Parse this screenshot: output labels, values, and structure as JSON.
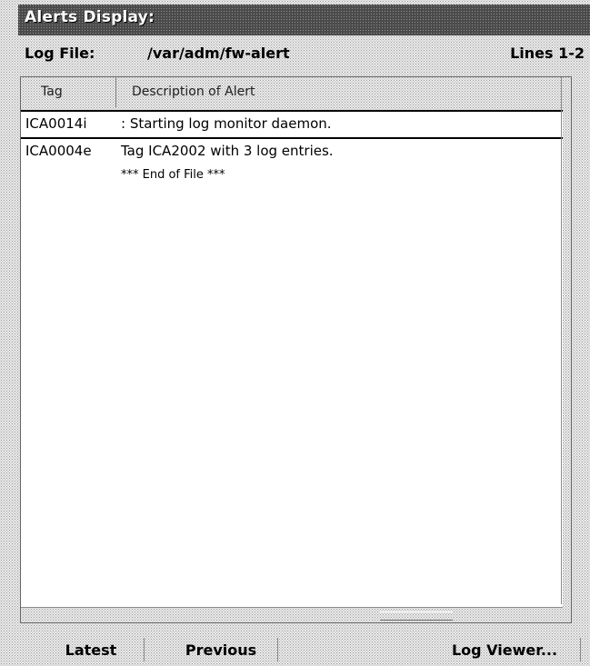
{
  "window": {
    "title": "Alerts Display:"
  },
  "logfile": {
    "label": "Log File:",
    "path": "/var/adm/fw-alert",
    "lines": "Lines 1-2"
  },
  "table": {
    "columns": [
      "Tag",
      "Description of Alert"
    ],
    "rows": [
      {
        "tag": "ICA0014i",
        "description": ": Starting log monitor daemon."
      },
      {
        "tag": "ICA0004e",
        "description": "Tag ICA2002 with 3 log entries."
      }
    ],
    "end_marker": "*** End of File ***"
  },
  "buttons": {
    "latest": "Latest",
    "previous": "Previous",
    "log_viewer": "Log Viewer..."
  }
}
